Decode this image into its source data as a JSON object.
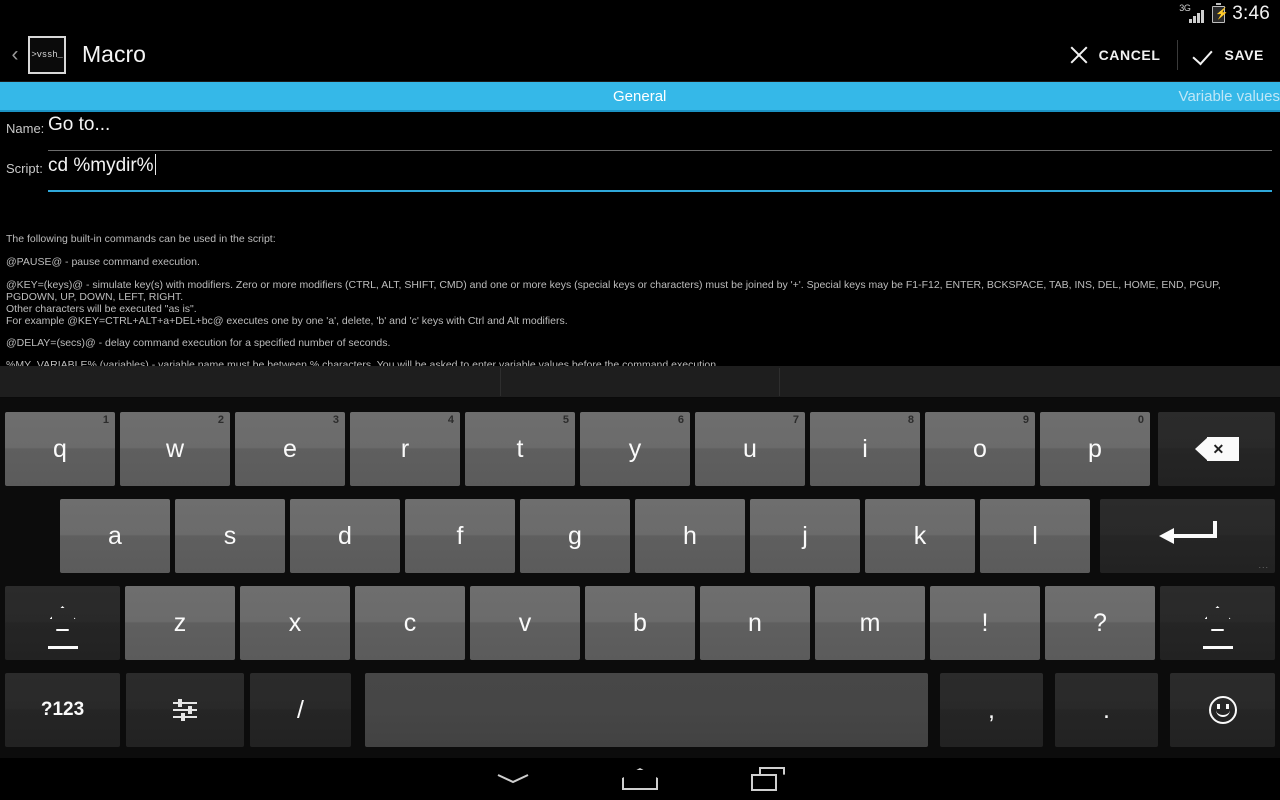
{
  "status_bar": {
    "network": "3G",
    "battery_icon": "battery-charging-icon",
    "time": "3:46"
  },
  "action_bar": {
    "back_icon": "back-chevron-icon",
    "app_icon_text": ">vssh_",
    "title": "Macro",
    "cancel_label": "CANCEL",
    "save_label": "SAVE"
  },
  "tabs": [
    {
      "label": "General",
      "active": true
    },
    {
      "label": "Variable values",
      "active": false
    }
  ],
  "form": {
    "name": {
      "label": "Name:",
      "value": "Go to..."
    },
    "script": {
      "label": "Script:",
      "value": "cd %mydir%",
      "focused": true
    }
  },
  "help": {
    "intro": "The following built-in commands can be used in the script:",
    "pause": "@PAUSE@ - pause command execution.",
    "key_line1": "@KEY=(keys)@ - simulate key(s) with modifiers. Zero or more modifiers (CTRL, ALT, SHIFT, CMD) and one or more keys (special keys or characters) must be joined by '+'. Special keys may be F1-F12, ENTER, BCKSPACE, TAB, INS, DEL, HOME, END, PGUP, PGDOWN, UP, DOWN, LEFT, RIGHT.",
    "key_line2": "Other characters will be executed \"as is\".",
    "key_line3": "For example @KEY=CTRL+ALT+a+DEL+bc@ executes one by one 'a', delete, 'b' and 'c' keys with Ctrl and Alt modifiers.",
    "delay": "@DELAY=(secs)@ - delay command execution for a specified number of seconds.",
    "variable": "%MY_VARIABLE% (variables) - variable name must be between % characters. You will be asked to enter variable values before the command execution."
  },
  "keyboard": {
    "row1": [
      {
        "key": "q",
        "num": "1"
      },
      {
        "key": "w",
        "num": "2"
      },
      {
        "key": "e",
        "num": "3"
      },
      {
        "key": "r",
        "num": "4"
      },
      {
        "key": "t",
        "num": "5"
      },
      {
        "key": "y",
        "num": "6"
      },
      {
        "key": "u",
        "num": "7"
      },
      {
        "key": "i",
        "num": "8"
      },
      {
        "key": "o",
        "num": "9"
      },
      {
        "key": "p",
        "num": "0"
      }
    ],
    "row2": [
      {
        "key": "a"
      },
      {
        "key": "s"
      },
      {
        "key": "d"
      },
      {
        "key": "f"
      },
      {
        "key": "g"
      },
      {
        "key": "h"
      },
      {
        "key": "j"
      },
      {
        "key": "k"
      },
      {
        "key": "l"
      }
    ],
    "row3": [
      {
        "key": "z"
      },
      {
        "key": "x"
      },
      {
        "key": "c"
      },
      {
        "key": "v"
      },
      {
        "key": "b"
      },
      {
        "key": "n"
      },
      {
        "key": "m"
      },
      {
        "key": "!"
      },
      {
        "key": "?"
      }
    ],
    "row4": [
      {
        "key": "?123"
      },
      {
        "key": "settings-icon"
      },
      {
        "key": "/"
      },
      {
        "key": "space"
      },
      {
        "key": ","
      },
      {
        "key": "."
      },
      {
        "key": "emoji-icon"
      }
    ],
    "backspace_icon": "backspace-icon",
    "enter_icon": "enter-icon",
    "shift_icon": "shift-icon",
    "enter_more": "..."
  },
  "nav_bar": {
    "hide_keyboard": "hide-keyboard-icon",
    "home": "home-icon",
    "recents": "recents-icon"
  },
  "colors": {
    "accent": "#35b8e8",
    "background": "#000000",
    "key_light": "#6b6b6b",
    "key_dark": "#272727"
  }
}
